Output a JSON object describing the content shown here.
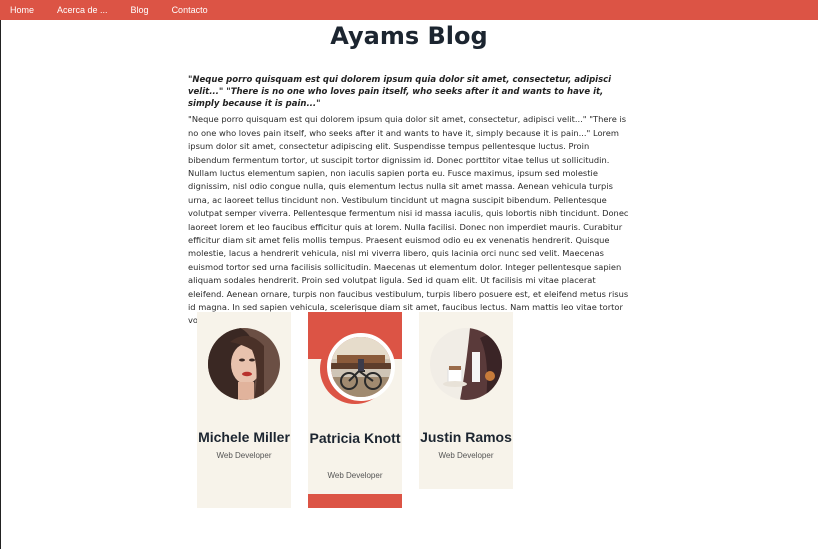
{
  "nav": {
    "items": [
      "Home",
      "Acerca de ...",
      "Blog",
      "Contacto"
    ]
  },
  "page": {
    "title": "Ayams Blog",
    "quote": "\"Neque porro quisquam est qui dolorem ipsum quia dolor sit amet, consectetur, adipisci velit...\" \"There is no one who loves pain itself, who seeks after it and wants to have it, simply because it is pain...\"",
    "body": "\"Neque porro quisquam est qui dolorem ipsum quia dolor sit amet, consectetur, adipisci velit...\" \"There is no one who loves pain itself, who seeks after it and wants to have it, simply because it is pain...\" Lorem ipsum dolor sit amet, consectetur adipiscing elit. Suspendisse tempus pellentesque luctus. Proin bibendum fermentum tortor, ut suscipit tortor dignissim id. Donec porttitor vitae tellus ut sollicitudin. Nullam luctus elementum sapien, non iaculis sapien porta eu. Fusce maximus, ipsum sed molestie dignissim, nisl odio congue nulla, quis elementum lectus nulla sit amet massa. Aenean vehicula turpis urna, ac laoreet tellus tincidunt non. Vestibulum tincidunt ut magna suscipit bibendum. Pellentesque volutpat semper viverra. Pellentesque fermentum nisi id massa iaculis, quis lobortis nibh tincidunt. Donec laoreet lorem et leo faucibus efficitur quis at lorem. Nulla facilisi. Donec non imperdiet mauris. Curabitur efficitur diam sit amet felis mollis tempus. Praesent euismod odio eu ex venenatis hendrerit. Quisque molestie, lacus a hendrerit vehicula, nisl mi viverra libero, quis lacinia orci nunc sed velit. Maecenas euismod tortor sed urna facilisis sollicitudin. Maecenas ut elementum dolor. Integer pellentesque sapien aliquam sodales hendrerit. Proin sed volutpat ligula. Sed id quam elit. Ut facilisis mi vitae placerat eleifend. Aenean ornare, turpis non faucibus vestibulum, turpis libero posuere est, et eleifend metus risus id magna. In sed sapien vehicula, scelerisque diam sit amet, faucibus lectus. Nam mattis leo vitae tortor volutpat tempus."
  },
  "team": [
    {
      "name": "Michele Miller",
      "role": "Web Developer",
      "icon": "woman-portrait-photo"
    },
    {
      "name": "Patricia Knott",
      "role": "Web Developer",
      "icon": "man-with-bicycle-photo"
    },
    {
      "name": "Justin Ramos",
      "role": "Web Developer",
      "icon": "man-with-coffee-photo"
    }
  ],
  "colors": {
    "accent": "#dc5445",
    "card_bg": "#f7f3ea",
    "title": "#1c2530"
  }
}
